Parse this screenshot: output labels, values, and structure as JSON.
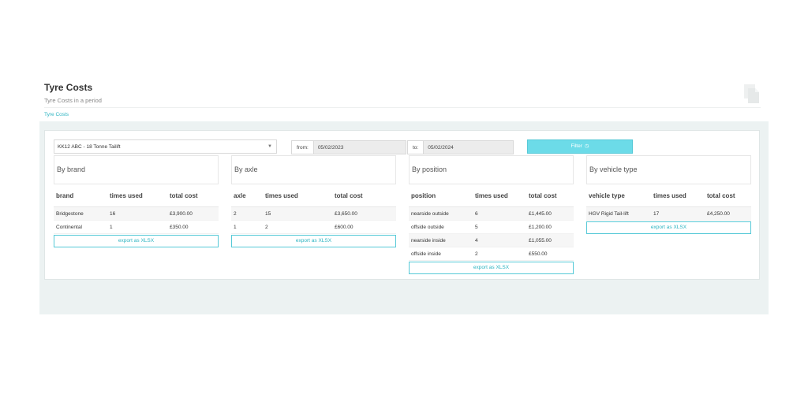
{
  "header": {
    "title": "Tyre Costs",
    "subtitle": "Tyre Costs in a period",
    "breadcrumb": "Tyre Costs",
    "icon": "document-copy-icon"
  },
  "filters": {
    "vehicle": "KK12 ABC - 18 Tonne Tailift",
    "from_label": "from:",
    "from_value": "05/02/2023",
    "to_label": "to:",
    "to_value": "05/02/2024",
    "filter_label": "Filter",
    "filter_icon": "clock-icon",
    "accent": "#6cdbe8"
  },
  "panels": {
    "brand": {
      "title": "By brand",
      "columns": [
        "brand",
        "times used",
        "total cost"
      ],
      "rows": [
        [
          "Bridgestone",
          "16",
          "£3,900.00"
        ],
        [
          "Continental",
          "1",
          "£350.00"
        ]
      ],
      "export": "export as XLSX"
    },
    "axle": {
      "title": "By axle",
      "columns": [
        "axle",
        "times used",
        "total cost"
      ],
      "rows": [
        [
          "2",
          "15",
          "£3,650.00"
        ],
        [
          "1",
          "2",
          "£600.00"
        ]
      ],
      "export": "export as XLSX"
    },
    "position": {
      "title": "By position",
      "columns": [
        "position",
        "times used",
        "total cost"
      ],
      "rows": [
        [
          "nearside outside",
          "6",
          "£1,445.00"
        ],
        [
          "offside outside",
          "5",
          "£1,200.00"
        ],
        [
          "nearside inside",
          "4",
          "£1,055.00"
        ],
        [
          "offside inside",
          "2",
          "£550.00"
        ]
      ],
      "export": "export as XLSX"
    },
    "vehicle_type": {
      "title": "By vehicle type",
      "columns": [
        "vehicle type",
        "times used",
        "total cost"
      ],
      "rows": [
        [
          "HGV Rigid Tail-lift",
          "17",
          "£4,250.00"
        ]
      ],
      "export": "export as XLSX"
    }
  }
}
